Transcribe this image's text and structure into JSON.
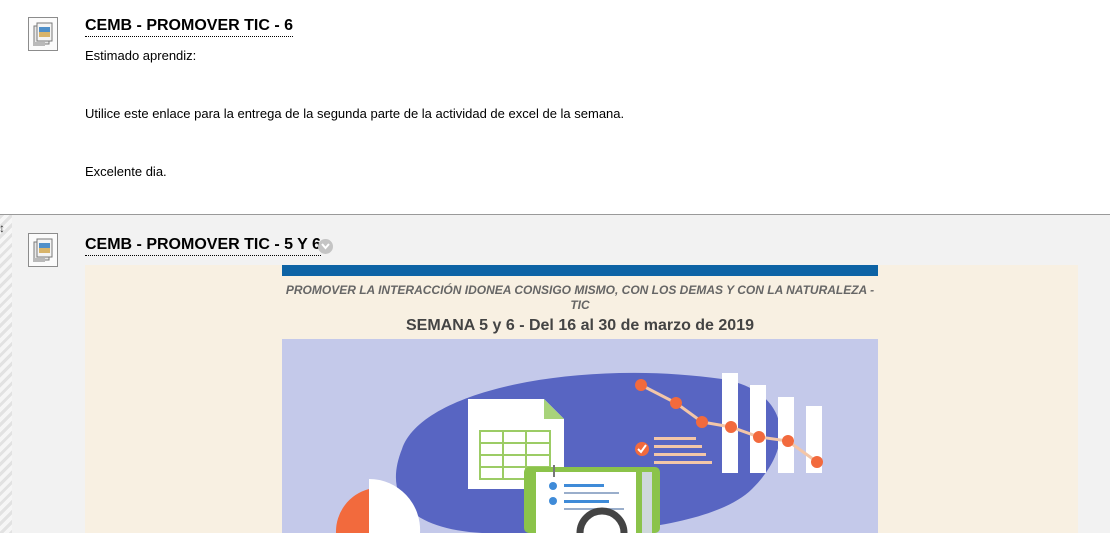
{
  "items": [
    {
      "title": "CEMB - PROMOVER TIC - 6",
      "paragraphs": [
        "Estimado aprendiz:",
        "Utilice este enlace para la entrega de la segunda parte de la actividad de excel de la semana.",
        "Excelente dia."
      ]
    },
    {
      "title": "CEMB - PROMOVER TIC - 5 Y 6",
      "banner": {
        "subtitle": "PROMOVER LA INTERACCIÓN IDONEA CONSIGO MISMO, CON LOS DEMAS Y CON LA NATURALEZA - TIC",
        "title": "SEMANA 5 y 6 - Del 16 al 30 de marzo de 2019"
      }
    }
  ],
  "icons": {
    "item_icon": "content-item-icon",
    "menu": "chevron-down-icon",
    "drag": "drag-handle-icon"
  },
  "colors": {
    "banner_bar": "#0d63a5",
    "banner_background": "#f8f0e2",
    "illustration_background": "#c4c9ea",
    "blob": "#5865c2",
    "accent_orange": "#f26a3d"
  }
}
